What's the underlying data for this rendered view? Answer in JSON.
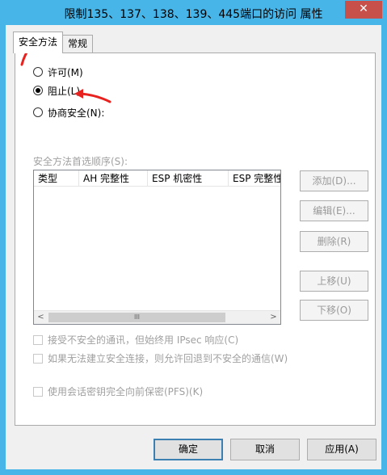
{
  "window": {
    "title": "限制135、137、138、139、445端口的访问 属性",
    "close_glyph": "✕"
  },
  "tabs": [
    {
      "label": "安全方法",
      "active": true
    },
    {
      "label": "常规",
      "active": false
    }
  ],
  "security_methods": {
    "options": [
      {
        "label": "许可(M)",
        "checked": false
      },
      {
        "label": "阻止(L)",
        "checked": true
      },
      {
        "label": "协商安全(N):",
        "checked": false
      }
    ],
    "order_label": "安全方法首选顺序(S):",
    "columns": [
      "类型",
      "AH 完整性",
      "ESP 机密性",
      "ESP 完整性"
    ],
    "scroll": {
      "left": "<",
      "right": ">",
      "thumb": "III"
    }
  },
  "side_buttons": {
    "add": "添加(D)...",
    "edit": "编辑(E)...",
    "delete": "删除(R)",
    "move_up": "上移(U)",
    "move_down": "下移(O)"
  },
  "checkboxes": [
    {
      "label": "接受不安全的通讯，但始终用 IPsec 响应(C)",
      "checked": false
    },
    {
      "label": "如果无法建立安全连接，则允许回退到不安全的通信(W)",
      "checked": false
    },
    {
      "label": "使用会话密钥完全向前保密(PFS)(K)",
      "checked": false
    }
  ],
  "footer": {
    "ok": "确定",
    "cancel": "取消",
    "apply": "应用(A)"
  },
  "colors": {
    "titlebar": "#48b5e8",
    "close": "#c7504a",
    "annotation_arrow": "#e8231f"
  }
}
